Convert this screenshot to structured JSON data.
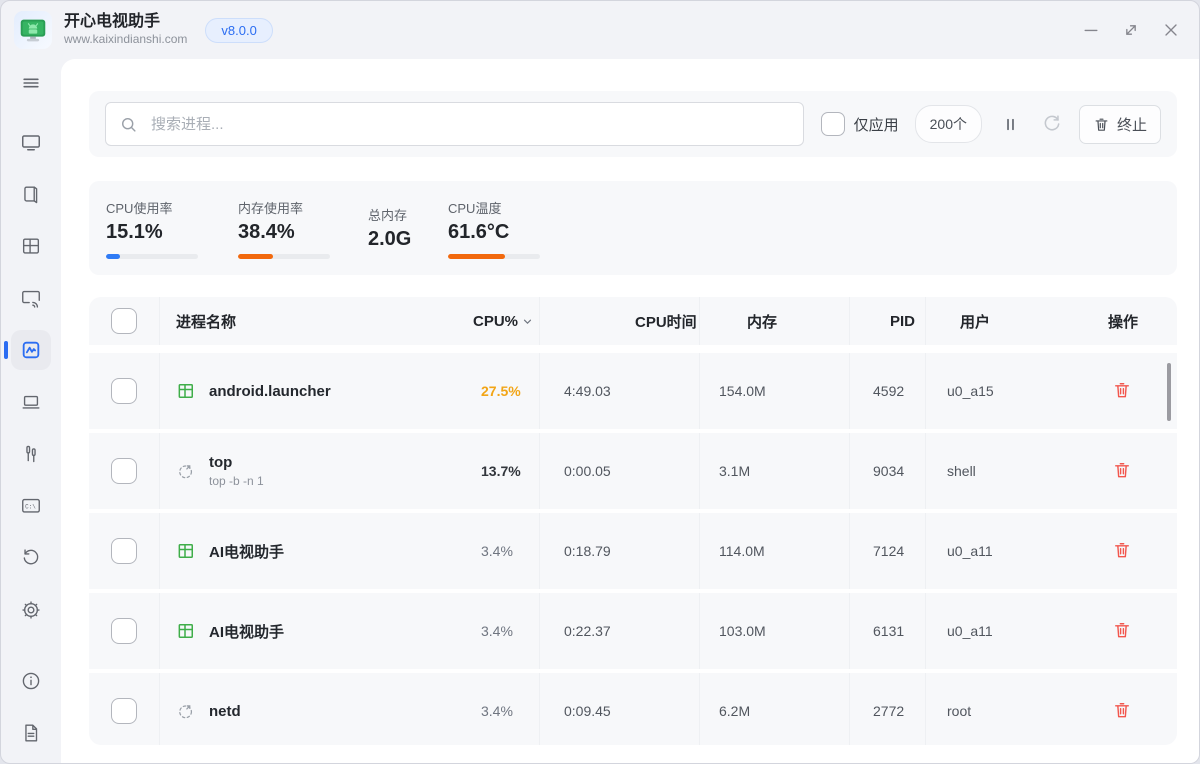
{
  "titlebar": {
    "app_title": "开心电视助手",
    "app_url": "www.kaixindianshi.com",
    "version_badge": "v8.0.0"
  },
  "sidebar": {
    "active_item": "performance",
    "icons": [
      "menu",
      "tv",
      "book",
      "apps",
      "screencast",
      "performance",
      "laptop",
      "tools",
      "terminal",
      "history",
      "settings",
      "info",
      "log-file"
    ]
  },
  "toolbar": {
    "search_placeholder": "搜索进程...",
    "apps_only_label": "仅应用",
    "process_count": "200个",
    "terminate_label": "终止"
  },
  "stats": [
    {
      "label": "CPU使用率",
      "value": "15.1%",
      "percent": 15,
      "bar_color": "#2f7bf5"
    },
    {
      "label": "内存使用率",
      "value": "38.4%",
      "percent": 38,
      "bar_color": "#f2690d"
    },
    {
      "label": "总内存",
      "value": "2.0G"
    },
    {
      "label": "CPU温度",
      "value": "61.6°C",
      "percent": 62,
      "bar_color": "#f2690d"
    }
  ],
  "table": {
    "headers": {
      "name": "进程名称",
      "cpu": "CPU%",
      "cpu_time": "CPU时间",
      "memory": "内存",
      "pid": "PID",
      "user": "用户",
      "action": "操作"
    },
    "rows": [
      {
        "name": "android.launcher",
        "icon": "app-window",
        "cpu": "27.5%",
        "cpu_style": "highlight",
        "cpu_time": "4:49.03",
        "memory": "154.0M",
        "pid": "4592",
        "user": "u0_a15"
      },
      {
        "name": "top",
        "subtitle": "top -b -n 1",
        "icon": "process",
        "cpu": "13.7%",
        "cpu_style": "bold",
        "cpu_time": "0:00.05",
        "memory": "3.1M",
        "pid": "9034",
        "user": "shell"
      },
      {
        "name": "AI电视助手",
        "icon": "app-window",
        "cpu": "3.4%",
        "cpu_style": "normal",
        "cpu_time": "0:18.79",
        "memory": "114.0M",
        "pid": "7124",
        "user": "u0_a11"
      },
      {
        "name": "AI电视助手",
        "icon": "app-window",
        "cpu": "3.4%",
        "cpu_style": "normal",
        "cpu_time": "0:22.37",
        "memory": "103.0M",
        "pid": "6131",
        "user": "u0_a11"
      },
      {
        "name": "netd",
        "icon": "process",
        "cpu": "3.4%",
        "cpu_style": "normal",
        "cpu_time": "0:09.45",
        "memory": "6.2M",
        "pid": "2772",
        "user": "root"
      }
    ]
  },
  "colors": {
    "accent_blue": "#2b6df2",
    "orange": "#f2690d",
    "cpu_highlight_amber": "#f2a516",
    "danger_red": "#f2564d",
    "app_icon_green": "#3fae49"
  }
}
